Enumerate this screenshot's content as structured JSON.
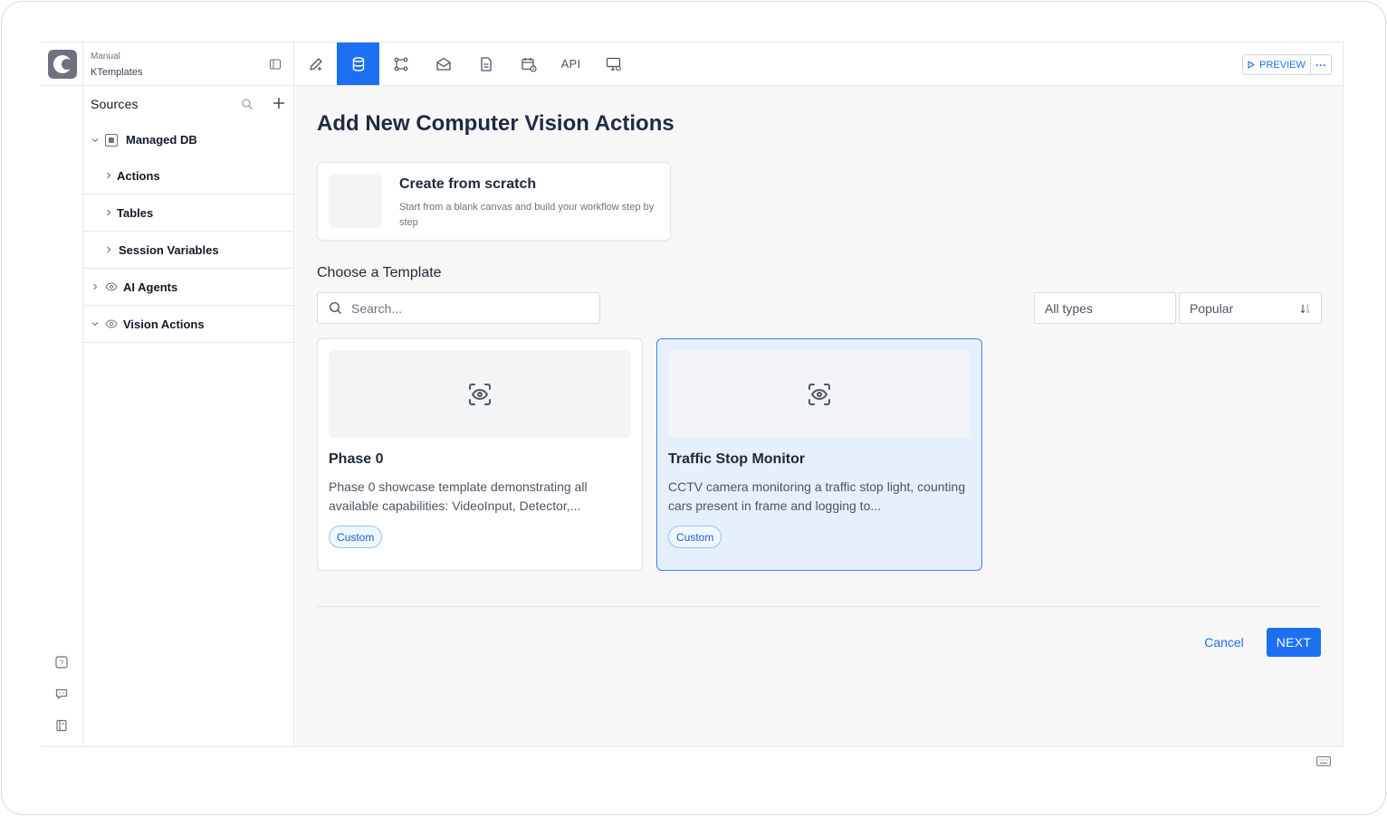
{
  "project": {
    "kind": "Manual",
    "name": "KTemplates"
  },
  "sidebar": {
    "title": "Sources",
    "tree": [
      {
        "label": "Managed DB",
        "expanded": true,
        "icon": "database-icon"
      },
      {
        "label": "Actions",
        "expanded": false,
        "child": true
      },
      {
        "label": "Tables",
        "expanded": false,
        "child": true
      },
      {
        "label": "Session Variables",
        "expanded": false,
        "child": true
      },
      {
        "label": "AI Agents",
        "expanded": false,
        "icon": "eye-icon"
      },
      {
        "label": "Vision Actions",
        "expanded": true,
        "icon": "eye-icon"
      }
    ]
  },
  "toolbar": {
    "items": [
      "edit-pencil-icon",
      "database-icon",
      "workflow-icon",
      "mail-icon",
      "document-icon",
      "calendar-icon",
      "API",
      "monitor-settings-icon"
    ],
    "active_index": 1,
    "api_label": "API",
    "preview_label": "PREVIEW",
    "more_label": "···"
  },
  "main": {
    "title": "Add New Computer Vision Actions",
    "scratch": {
      "title": "Create from scratch",
      "description": "Start from a blank canvas and build your workflow step by step"
    },
    "choose_title": "Choose a Template",
    "search_placeholder": "Search...",
    "type_filter": "All types",
    "sort": "Popular",
    "templates": [
      {
        "title": "Phase 0",
        "description": "Phase 0 showcase template demonstrating all available capabilities: VideoInput, Detector,...",
        "badge": "Custom",
        "selected": false
      },
      {
        "title": "Traffic Stop Monitor",
        "description": "CCTV camera monitoring a traffic stop light, counting cars present in frame and logging to...",
        "badge": "Custom",
        "selected": true
      }
    ],
    "cancel_label": "Cancel",
    "next_label": "NEXT"
  },
  "colors": {
    "accent": "#1d6ff2",
    "selected_card_bg": "#e6effc",
    "badge_border": "#93c5fd"
  }
}
